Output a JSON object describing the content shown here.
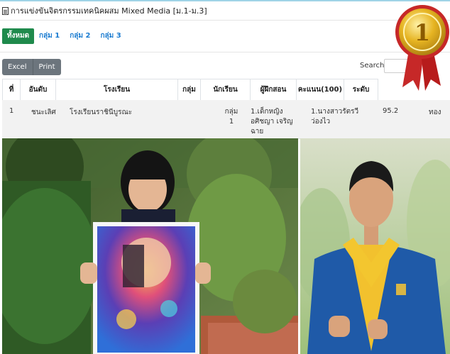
{
  "page": {
    "title": "การแข่งขันจิตรกรรมเทคนิคผสม Mixed Media [ม.1-ม.3]"
  },
  "tabs": [
    {
      "label": "ทั้งหมด",
      "active": true
    },
    {
      "label": "กลุ่ม 1",
      "active": false
    },
    {
      "label": "กลุ่ม 2",
      "active": false
    },
    {
      "label": "กลุ่ม 3",
      "active": false
    }
  ],
  "toolbar": {
    "excel_label": "Excel",
    "print_label": "Print",
    "search_label": "Search:",
    "search_value": ""
  },
  "table": {
    "headers": [
      "ที่",
      "อันดับ",
      "โรงเรียน",
      "กลุ่ม",
      "นักเรียน",
      "ผู้ฝึกสอน",
      "คะแนน(100)",
      "ระดับ"
    ],
    "rows": [
      {
        "no": "1",
        "rank": "ชนะเลิศ",
        "school": "โรงเรียนราชินีบูรณะ",
        "group": "กลุ่ม 1",
        "student": "1.เด็กหญิง อศิชญา เจริญฉาย",
        "coach": "1.นางสาวรัตรวี ว่องไว",
        "score": "95.2",
        "level": "ทอง"
      }
    ]
  },
  "medal": {
    "number": "1"
  },
  "colors": {
    "active_tab": "#1f8a4c",
    "tab_link": "#1a7bd0",
    "button": "#6c757d",
    "ribbon": "#c62828",
    "gold": "#e6b422"
  }
}
